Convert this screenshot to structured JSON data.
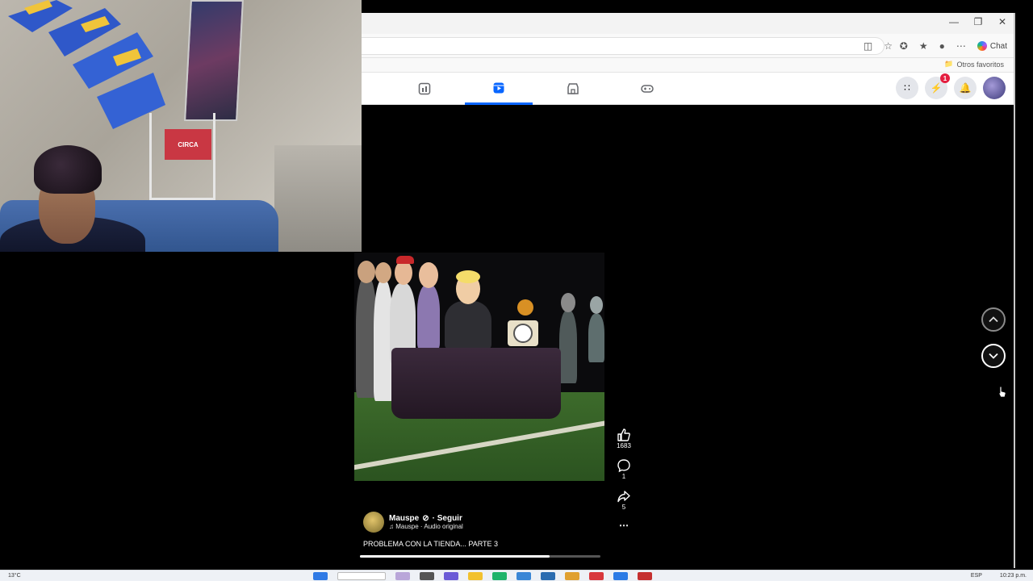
{
  "browser": {
    "copilot_label": "Chat",
    "favorites_folder": "Otros favoritos"
  },
  "fb_nav": {
    "tabs": [
      {
        "icon": "pages-icon",
        "active": false
      },
      {
        "icon": "reels-icon",
        "active": true
      },
      {
        "icon": "marketplace-icon",
        "active": false
      },
      {
        "icon": "gaming-icon",
        "active": false
      }
    ],
    "messenger_badge": "1"
  },
  "reel": {
    "author": "Mauspe",
    "verified_mark": "⊘",
    "follow_label": "· Seguir",
    "audio": "♫ Mauspe · Audio original",
    "caption": "PROBLEMA CON LA TIENDA... PARTE 3",
    "likes": "1683",
    "comments": "1",
    "shares": "5",
    "progress_fraction": 0.79
  },
  "webcam": {
    "sign_text": "CIRCA"
  },
  "taskbar": {
    "temperature": "13°C",
    "lang": "ESP",
    "time": "10:23 p.m."
  },
  "colors": {
    "accent": "#0866ff",
    "badge": "#e41e3f"
  }
}
